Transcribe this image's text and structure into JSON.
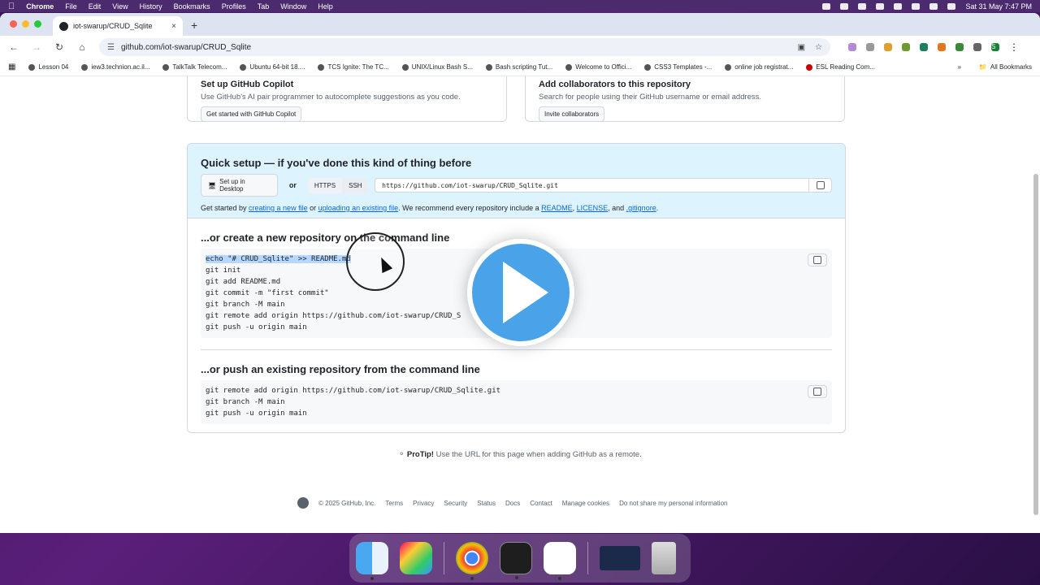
{
  "menubar": {
    "app": "Chrome",
    "items": [
      "File",
      "Edit",
      "View",
      "History",
      "Bookmarks",
      "Profiles",
      "Tab",
      "Window",
      "Help"
    ],
    "clock": "Sat 31 May  7:47 PM"
  },
  "tab": {
    "title": "iot-swarup/CRUD_Sqlite",
    "close": "×",
    "new": "+"
  },
  "toolbar": {
    "url": "github.com/iot-swarup/CRUD_Sqlite",
    "avatar": "S"
  },
  "bookmarks": [
    "Lesson 04",
    "iew3.technion.ac.il...",
    "TalkTalk Telecom...",
    "Ubuntu 64-bit 18....",
    "TCS Ignite: The TC...",
    "UNIX/Linux Bash S...",
    "Bash scripting Tut...",
    "Welcome to Offici...",
    "CSS3 Templates -...",
    "online job registrat...",
    "ESL Reading Com..."
  ],
  "all_bookmarks": "All Bookmarks",
  "copilot": {
    "title": "Set up GitHub Copilot",
    "desc": "Use GitHub's AI pair programmer to autocomplete suggestions as you code.",
    "button": "Get started with GitHub Copilot"
  },
  "collab": {
    "title": "Add collaborators to this repository",
    "desc": "Search for people using their GitHub username or email address.",
    "button": "Invite collaborators"
  },
  "quick": {
    "title": "Quick setup — if you've done this kind of thing before",
    "desktop_button": "Set up in Desktop",
    "or": "or",
    "https": "HTTPS",
    "ssh": "SSH",
    "clone_url": "https://github.com/iot-swarup/CRUD_Sqlite.git",
    "gs_prefix": "Get started by ",
    "gs_link1": "creating a new file",
    "gs_mid1": " or ",
    "gs_link2": "uploading an existing file",
    "gs_mid2": ". We recommend every repository include a ",
    "gs_link3": "README",
    "gs_comma1": ", ",
    "gs_link4": "LICENSE",
    "gs_and": ", and ",
    "gs_link5": ".gitignore",
    "gs_end": "."
  },
  "create": {
    "title": "...or create a new repository on the command line",
    "lines": [
      "echo \"# CRUD_Sqlite\" >> README.md",
      "git init",
      "git add README.md",
      "git commit -m \"first commit\"",
      "git branch -M main",
      "git remote add origin https://github.com/iot-swarup/CRUD_S",
      "git push -u origin main"
    ]
  },
  "push": {
    "title": "...or push an existing repository from the command line",
    "lines": [
      "git remote add origin https://github.com/iot-swarup/CRUD_Sqlite.git",
      "git branch -M main",
      "git push -u origin main"
    ]
  },
  "protip": {
    "label": "ProTip!",
    "text": " Use the URL for this page when adding GitHub as a remote."
  },
  "footer": {
    "copyright": "© 2025 GitHub, Inc.",
    "links": [
      "Terms",
      "Privacy",
      "Security",
      "Status",
      "Docs",
      "Contact",
      "Manage cookies",
      "Do not share my personal information"
    ]
  },
  "colors": {
    "accent": "#0969da",
    "quick_bg": "#ddf4ff",
    "play": "#4aa3e8"
  }
}
